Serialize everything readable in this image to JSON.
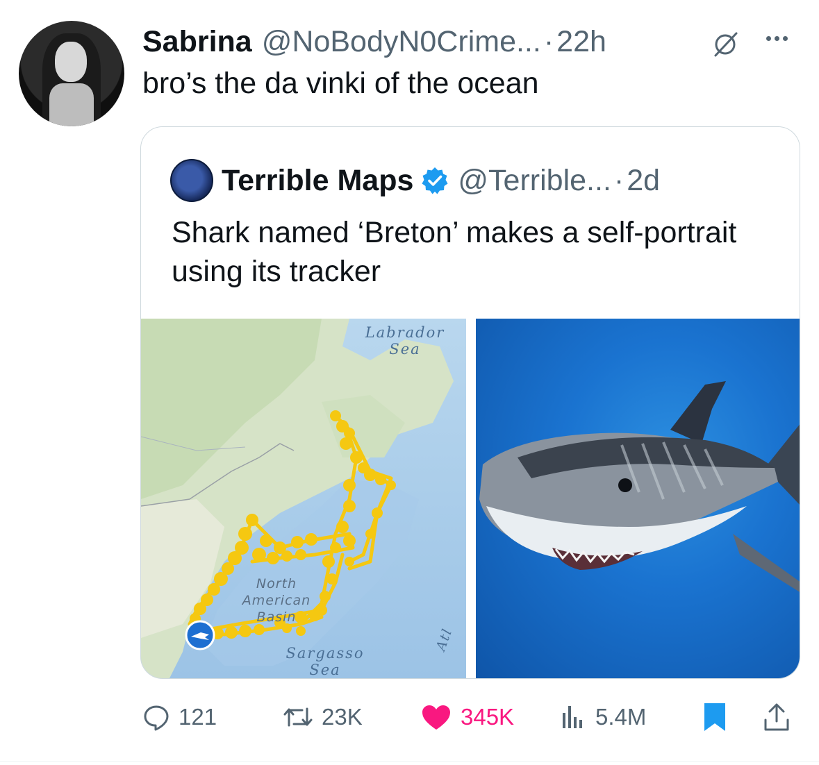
{
  "tweet": {
    "author_name": "Sabrina",
    "author_handle": "@NoBodyN0Crime...",
    "separator": "·",
    "time": "22h",
    "text": "bro’s the da vinki of the ocean"
  },
  "quoted_tweet": {
    "author_name": "Terrible Maps",
    "author_handle": "@Terrible...",
    "separator": "·",
    "time": "2d",
    "text": "Shark named ‘Breton’ makes a self-portrait using its tracker",
    "map": {
      "labels": {
        "labrador_sea": [
          "Labrador",
          "Sea"
        ],
        "north_american_basin": [
          "North",
          "American",
          "Basin"
        ],
        "sargasso_sea": [
          "Sargasso",
          "Sea"
        ],
        "atlantic_partial": "Atl"
      }
    }
  },
  "stats": {
    "replies": "121",
    "reposts": "23K",
    "likes": "345K",
    "views": "5.4M"
  },
  "colors": {
    "text_primary": "#0f1419",
    "text_secondary": "#536471",
    "like_pink": "#f91880",
    "verified_blue": "#1d9bf0",
    "bookmark_blue": "#1d9bf0",
    "track_yellow": "#f5c811"
  }
}
